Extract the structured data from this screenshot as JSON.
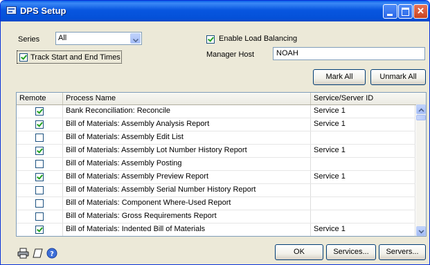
{
  "window": {
    "title": "DPS Setup"
  },
  "series": {
    "label": "Series",
    "value": "All"
  },
  "track_times": {
    "label": "Track Start and End Times",
    "checked": true
  },
  "load_balancing": {
    "label": "Enable Load Balancing",
    "checked": true
  },
  "manager_host": {
    "label": "Manager Host",
    "value": "NOAH"
  },
  "buttons": {
    "mark_all": "Mark All",
    "unmark_all": "Unmark All",
    "ok": "OK",
    "services": "Services...",
    "servers": "Servers..."
  },
  "table": {
    "headers": [
      "Remote",
      "Process Name",
      "Service/Server ID"
    ],
    "rows": [
      {
        "remote": true,
        "process": "Bank Reconciliation: Reconcile",
        "service": "Service 1"
      },
      {
        "remote": true,
        "process": "Bill of Materials: Assembly Analysis Report",
        "service": "Service 1"
      },
      {
        "remote": false,
        "process": "Bill of Materials: Assembly Edit List",
        "service": ""
      },
      {
        "remote": true,
        "process": "Bill of Materials: Assembly Lot Number History Report",
        "service": "Service 1"
      },
      {
        "remote": false,
        "process": "Bill of Materials: Assembly Posting",
        "service": ""
      },
      {
        "remote": true,
        "process": "Bill of Materials: Assembly Preview Report",
        "service": "Service 1"
      },
      {
        "remote": false,
        "process": "Bill of Materials: Assembly Serial Number History Report",
        "service": ""
      },
      {
        "remote": false,
        "process": "Bill of Materials: Component Where-Used Report",
        "service": ""
      },
      {
        "remote": false,
        "process": "Bill of Materials: Gross Requirements Report",
        "service": ""
      },
      {
        "remote": true,
        "process": "Bill of Materials: Indented Bill of Materials",
        "service": "Service 1"
      }
    ]
  },
  "icons": [
    "printer-icon",
    "note-icon",
    "help-icon"
  ]
}
